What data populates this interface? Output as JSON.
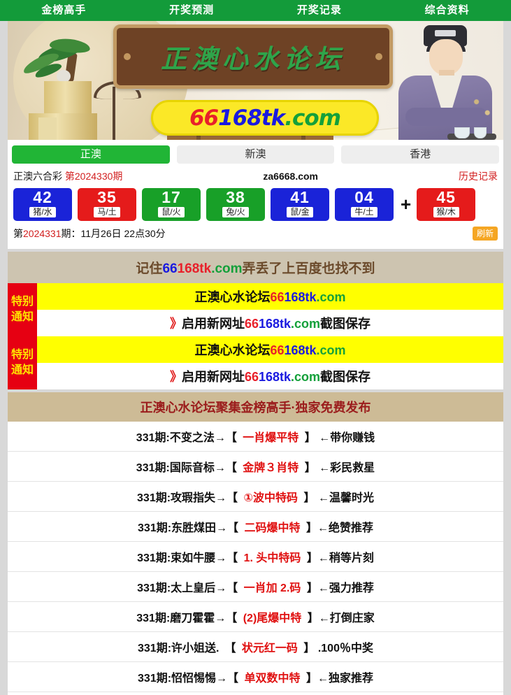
{
  "topnav": {
    "items": [
      {
        "label": "金榜高手"
      },
      {
        "label": "开奖预测"
      },
      {
        "label": "开奖记录"
      },
      {
        "label": "综合资料"
      }
    ]
  },
  "banner": {
    "plaque_text": "正澳心水论坛",
    "domain_parts": [
      {
        "text": "66",
        "color": "#e8202a"
      },
      {
        "text": "168",
        "color": "#1a1ae0"
      },
      {
        "text": "tk",
        "color": "#1a1ae0"
      },
      {
        "text": ".com",
        "color": "#14a03a"
      }
    ],
    "domain_full": "66168tk.com"
  },
  "tabs": [
    {
      "label": "正澳",
      "active": true
    },
    {
      "label": "新澳",
      "active": false
    },
    {
      "label": "香港",
      "active": false
    }
  ],
  "draw": {
    "title": "正澳六合彩",
    "issue": "第2024330期",
    "site": "za6668.com",
    "history_label": "历史记录",
    "balls": [
      {
        "num": "42",
        "zodiac": "猪/水",
        "color": "blue"
      },
      {
        "num": "35",
        "zodiac": "马/土",
        "color": "red"
      },
      {
        "num": "17",
        "zodiac": "鼠/火",
        "color": "green"
      },
      {
        "num": "38",
        "zodiac": "兔/火",
        "color": "green"
      },
      {
        "num": "41",
        "zodiac": "鼠/金",
        "color": "blue"
      },
      {
        "num": "04",
        "zodiac": "牛/土",
        "color": "blue"
      }
    ],
    "plus": "+",
    "special": {
      "num": "45",
      "zodiac": "猴/木",
      "color": "red"
    },
    "next_prefix": "第",
    "next_issue": "2024331",
    "next_suffix": "期：11月26日 22点30分",
    "refresh_label": "刷新"
  },
  "memo": {
    "pre": "记住",
    "d1": "66",
    "d2": "168tk",
    "d3": ".com",
    "post": "弄丢了上百度也找不到"
  },
  "notices": [
    {
      "tag_line1": "特别",
      "tag_line2": "通知",
      "row1": {
        "text": "正澳心水论坛",
        "d1": "66",
        "d2": "168tk",
        "d3": ".com"
      },
      "row2": {
        "arrows": "》",
        "pre": "启用新网址",
        "d1": "66",
        "d2": "168tk",
        "d3": ".com",
        "post": "截图保存"
      }
    },
    {
      "tag_line1": "特别",
      "tag_line2": "通知",
      "row1": {
        "text": "正澳心水论坛",
        "d1": "66",
        "d2": "168tk",
        "d3": ".com"
      },
      "row2": {
        "arrows": "》",
        "pre": "启用新网址",
        "d1": "66",
        "d2": "168tk",
        "d3": ".com",
        "post": "截图保存"
      }
    }
  ],
  "list": {
    "header": "正澳心水论坛聚集金榜高手·独家免费发布",
    "items": [
      {
        "prefix": "331期:不变之法→【",
        "mid": " 一肖爆平特 ",
        "suffix": "】 ←带你赚钱"
      },
      {
        "prefix": "331期:国际音标→【",
        "mid": " 金牌３肖特 ",
        "suffix": "】 ←彩民救星"
      },
      {
        "prefix": "331期:攻瑕指失→【",
        "mid": " ①波中特码 ",
        "suffix": "】 ←温馨时光"
      },
      {
        "prefix": "331期:东胜煤田→【",
        "mid": " 二码爆中特 ",
        "suffix": "】←绝赞推荐"
      },
      {
        "prefix": "331期:束如牛腰→【",
        "mid": " 1. 头中特码 ",
        "suffix": "】←稍等片刻"
      },
      {
        "prefix": "331期:太上皇后→【",
        "mid": " 一肖加 2.码 ",
        "suffix": "】←强力推荐"
      },
      {
        "prefix": "331期:磨刀霍霍→【",
        "mid": " (2)尾爆中特 ",
        "suffix": "】←打倒庄家"
      },
      {
        "prefix": "331期:许小姐送.　【",
        "mid": " 状元红一码 ",
        "suffix": "】 .100％中奖"
      },
      {
        "prefix": "331期:怊怊惕惕→【",
        "mid": " 单双数中特 ",
        "suffix": "】←独家推荐"
      }
    ]
  },
  "colors": {
    "nav_green": "#139b3a",
    "tab_green": "#21b536",
    "ball_blue": "#1a23d8",
    "ball_red": "#e51b1b",
    "ball_green": "#18a028",
    "notice_red": "#e60012",
    "notice_yellow": "#ffff00",
    "tag_text_yellow": "#ffe400",
    "memo_bg": "#cdc4b0",
    "list_header_bg": "#cdbb96",
    "list_header_text": "#9b1c1c",
    "refresh_orange": "#f5a623",
    "page_bg": "#d8d8d8"
  }
}
